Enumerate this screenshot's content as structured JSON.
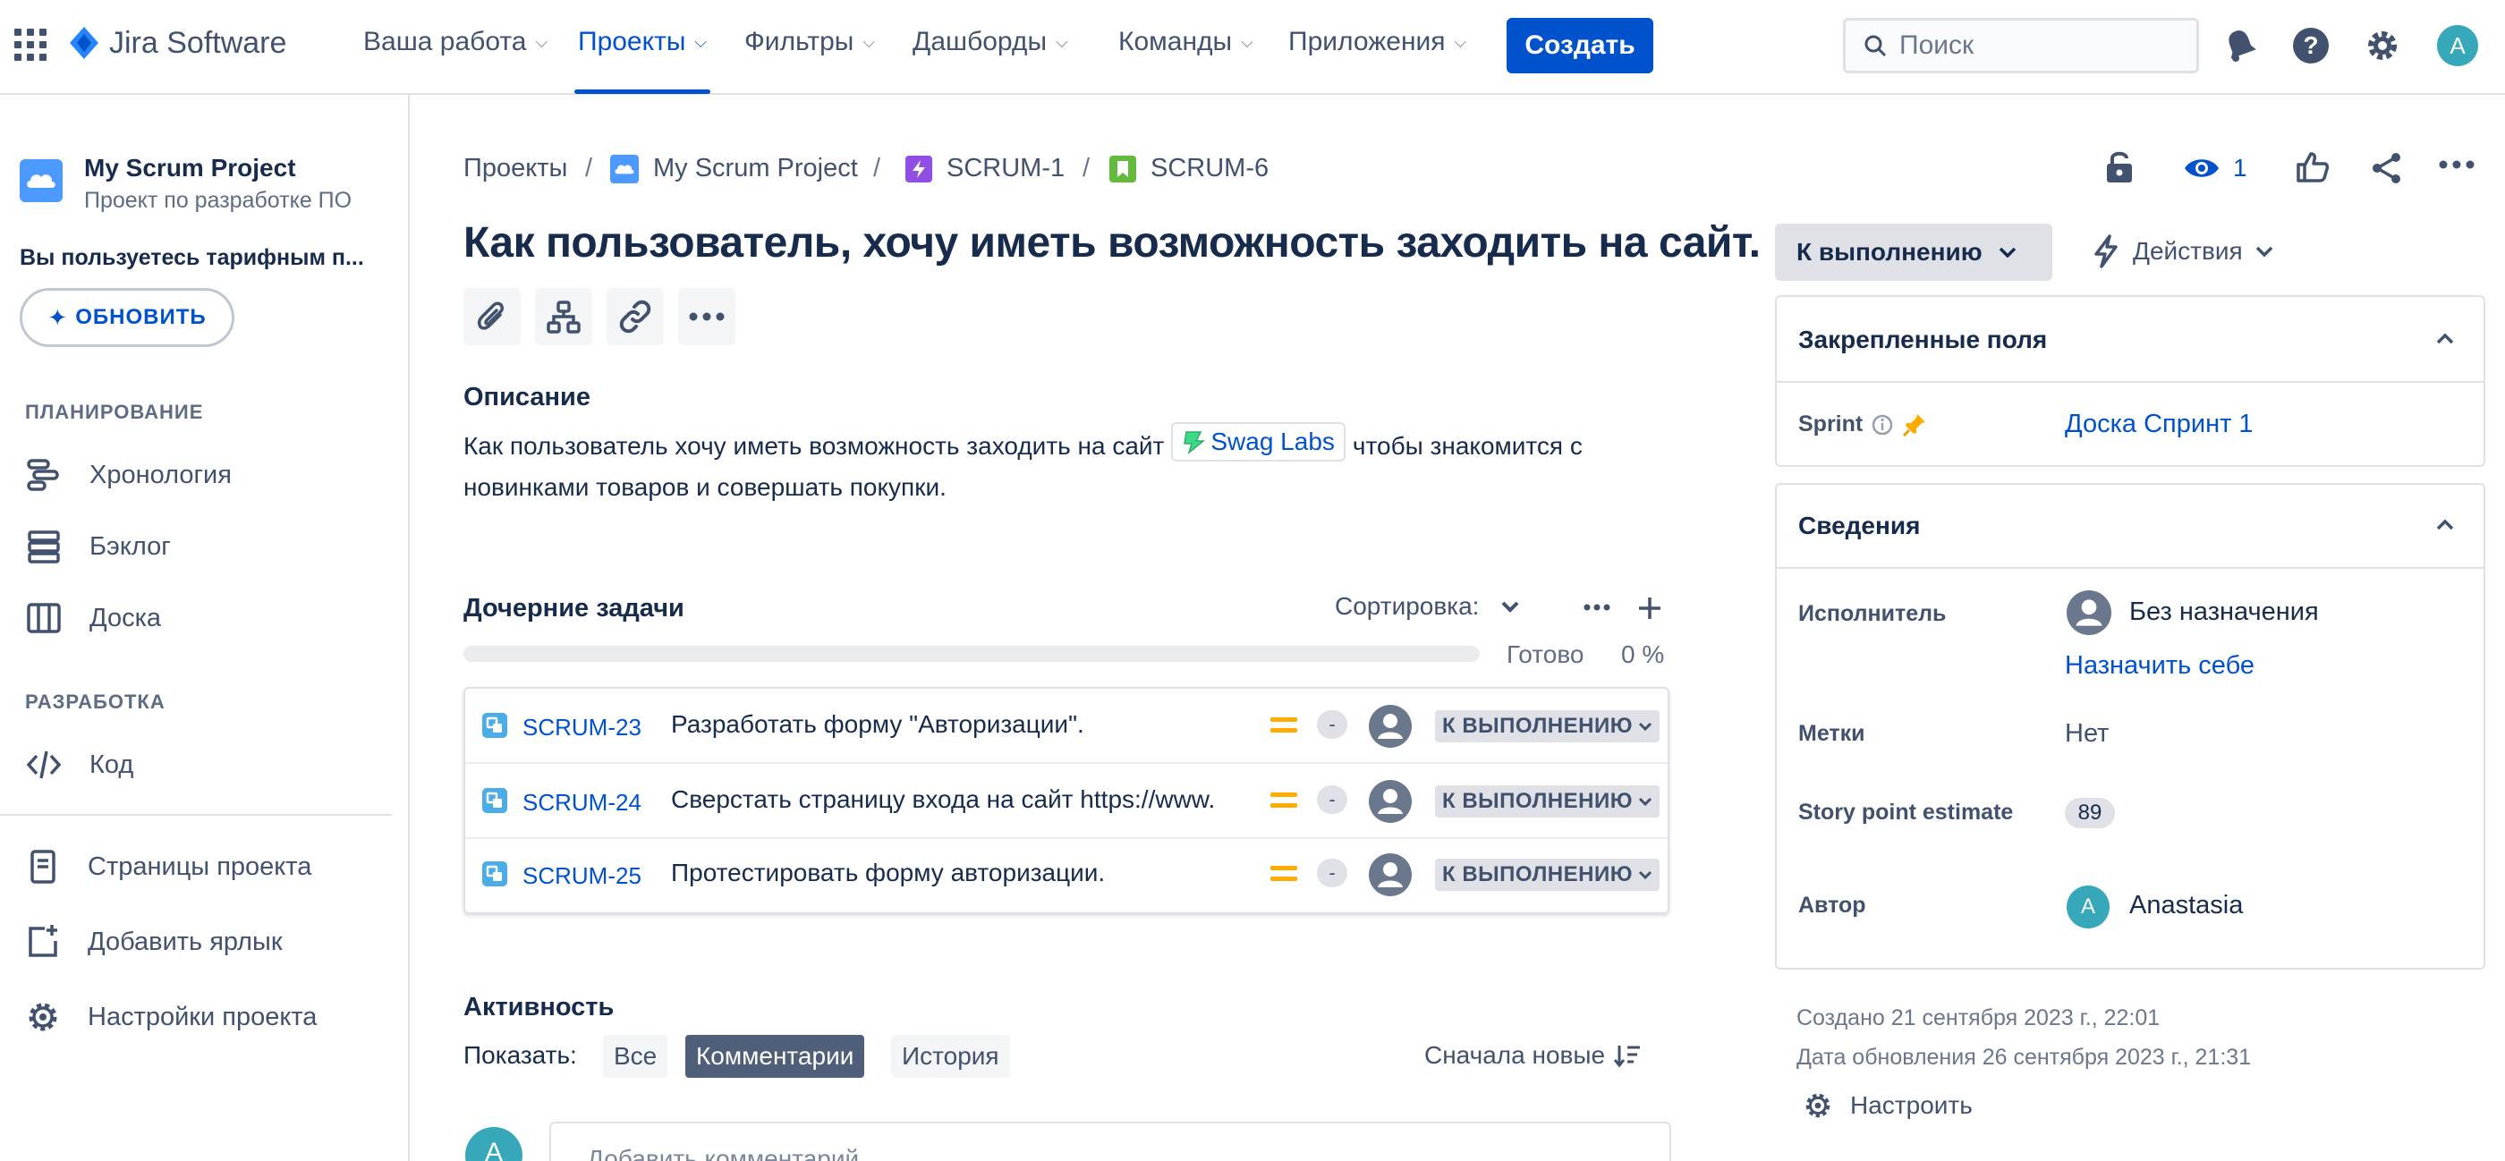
{
  "topnav": {
    "product_name": "Jira Software",
    "items": [
      {
        "label": "Ваша работа"
      },
      {
        "label": "Проекты"
      },
      {
        "label": "Фильтры"
      },
      {
        "label": "Дашборды"
      },
      {
        "label": "Команды"
      },
      {
        "label": "Приложения"
      }
    ],
    "create_label": "Создать",
    "search_placeholder": "Поиск",
    "avatar_initial": "A"
  },
  "sidebar": {
    "project_name": "My Scrum Project",
    "project_type": "Проект по разработке ПО",
    "plan_notice": "Вы пользуетесь тарифным п...",
    "upgrade_label": "ОБНОВИТЬ",
    "section_planning": "ПЛАНИРОВАНИЕ",
    "section_dev": "РАЗРАБОТКА",
    "items": {
      "timeline": "Хронология",
      "backlog": "Бэклог",
      "board": "Доска",
      "code": "Код",
      "pages": "Страницы проекта",
      "shortcut": "Добавить ярлык",
      "settings": "Настройки проекта"
    }
  },
  "breadcrumb": {
    "projects": "Проекты",
    "project": "My Scrum Project",
    "epic": "SCRUM-1",
    "issue": "SCRUM-6",
    "separator": "/"
  },
  "issue": {
    "title": "Как пользователь, хочу иметь возможность заходить на сайт.",
    "watchers": "1",
    "description_heading": "Описание",
    "description_before": "Как пользователь хочу иметь возможность заходить на сайт",
    "description_link": "Swag Labs",
    "description_after": "чтобы знакомится с новинками товаров и совершать покупки."
  },
  "child_issues": {
    "heading": "Дочерние задачи",
    "sort_label": "Сортировка:",
    "progress_label": "Готово",
    "progress_value": "0 %",
    "progress_fraction": 0,
    "rows": [
      {
        "key": "SCRUM-23",
        "summary": "Разработать форму \"Авторизации\".",
        "dash": "-",
        "status": "К ВЫПОЛНЕНИЮ"
      },
      {
        "key": "SCRUM-24",
        "summary": "Сверстать страницу входа на сайт https://www.",
        "dash": "-",
        "status": "К ВЫПОЛНЕНИЮ"
      },
      {
        "key": "SCRUM-25",
        "summary": "Протестировать форму авторизации.",
        "dash": "-",
        "status": "К ВЫПОЛНЕНИЮ"
      }
    ]
  },
  "activity": {
    "heading": "Активность",
    "show_label": "Показать:",
    "filters": [
      "Все",
      "Комментарии",
      "История"
    ],
    "selected_filter": "Комментарии",
    "order_label": "Сначала новые",
    "comment_placeholder": "Добавить комментарий...",
    "avatar_initial": "A"
  },
  "details": {
    "status_label": "К выполнению",
    "actions_label": "Действия",
    "pinned_heading": "Закрепленные поля",
    "sprint_label": "Sprint",
    "sprint_value": "Доска Спринт 1",
    "info_heading": "Сведения",
    "assignee_label": "Исполнитель",
    "assignee_value": "Без назначения",
    "assign_self": "Назначить себе",
    "labels_label": "Метки",
    "labels_value": "Нет",
    "story_points_label": "Story point estimate",
    "story_points_value": "89",
    "reporter_label": "Автор",
    "reporter_value": "Anastasia",
    "reporter_initial": "A",
    "created": "Создано 21 сентября 2023 г., 22:01",
    "updated": "Дата обновления 26 сентября 2023 г., 21:31",
    "configure_label": "Настроить"
  },
  "colors": {
    "accent": "#0052CC",
    "priority_medium": "#FFAB00",
    "subtask": "#4BADE8",
    "epic": "#904EE2",
    "story": "#63BA3C",
    "avatar_teal": "#37A8B9"
  }
}
